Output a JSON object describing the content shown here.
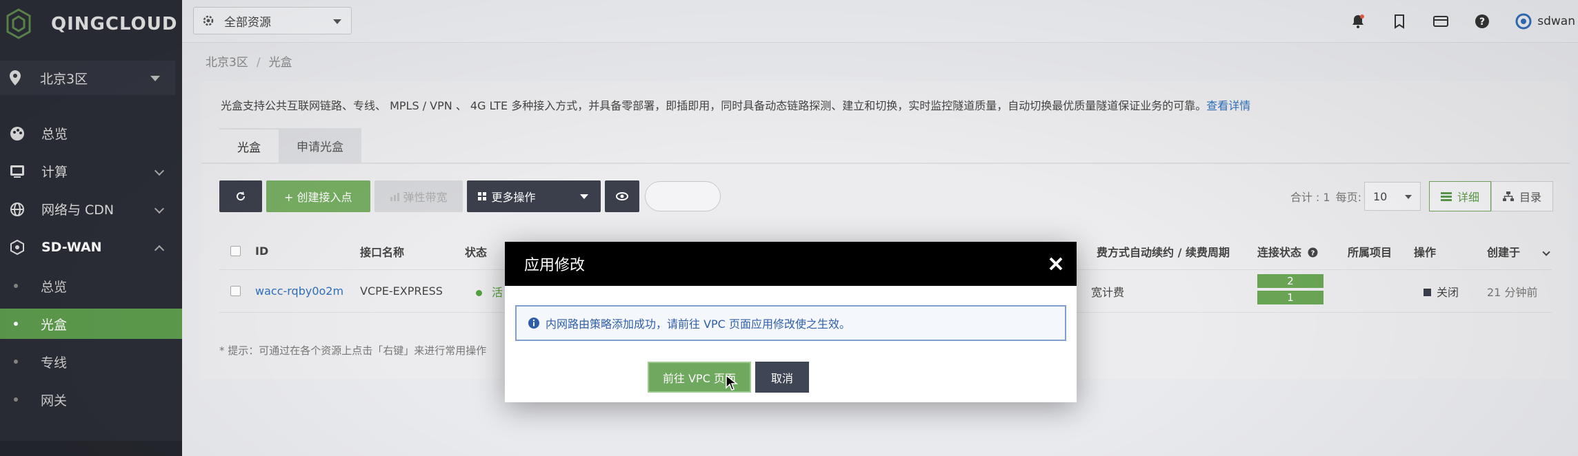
{
  "app": {
    "brand": "QINGCLOUD"
  },
  "sidebar": {
    "region": "北京3区",
    "items": [
      {
        "label": "总览"
      },
      {
        "label": "计算"
      },
      {
        "label": "网络与 CDN"
      },
      {
        "label": "SD-WAN"
      }
    ],
    "sub_items": [
      {
        "label": "总览"
      },
      {
        "label": "光盒"
      },
      {
        "label": "专线"
      },
      {
        "label": "网关"
      }
    ]
  },
  "topbar": {
    "resource_select": "全部资源",
    "user": "sdwan"
  },
  "breadcrumb": {
    "region": "北京3区",
    "separator": "/",
    "current": "光盒"
  },
  "notice": {
    "text": "光盒支持公共互联网链路、专线、 MPLS / VPN 、 4G LTE 多种接入方式，并具备零部署，即插即用，同时具备动态链路探测、建立和切换，实时监控隧道质量，自动切换最优质量隧道保证业务的可靠。",
    "link": "查看详情"
  },
  "tabs": [
    {
      "label": "光盒"
    },
    {
      "label": "申请光盒"
    }
  ],
  "toolbar": {
    "create": "+ 创建接入点",
    "elastic": "弹性带宽",
    "more": "更多操作",
    "total": "合计 : 1",
    "per_page_label": "每页:",
    "per_page": "10",
    "detail": "详细",
    "catalog": "目录"
  },
  "table": {
    "columns": {
      "id": "ID",
      "name": "接口名称",
      "status": "状态",
      "billing": "费方式",
      "renew": "自动续约 / 续费周期",
      "conn": "连接状态",
      "project": "所属项目",
      "ops": "操作",
      "created": "创建于"
    },
    "rows": [
      {
        "id": "wacc-rqby0o2m",
        "name": "VCPE-EXPRESS",
        "status": "活",
        "billing": "宽计费",
        "conn_up": "2",
        "conn_down": "1",
        "op": "关闭",
        "created": "21 分钟前"
      }
    ]
  },
  "hint": "* 提示：可通过在各个资源上点击「右键」来进行常用操作",
  "modal": {
    "title": "应用修改",
    "message": "内网路由策略添加成功，请前往 VPC 页面应用修改使之生效。",
    "primary": "前往 VPC 页面",
    "cancel": "取消"
  },
  "colors": {
    "accent_green": "#6fa85f",
    "sidebar_bg": "#2a2d36",
    "link_blue": "#2f6fba"
  }
}
